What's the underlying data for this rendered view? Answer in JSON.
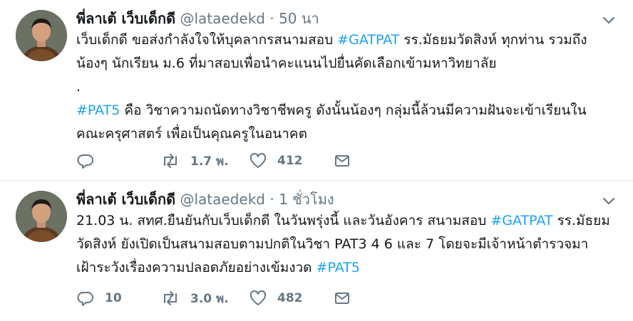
{
  "colors": {
    "link": "#1da1f2",
    "muted": "#657786",
    "text": "#14171a",
    "divider": "#e6ecf0"
  },
  "tweets": [
    {
      "author_name": "พี่ลาเต้ เว็บเด็กดี",
      "handle": "@lataedekd",
      "separator": "·",
      "time": "50 นา",
      "lines": [
        [
          {
            "text": "เว็บเด็กดี ขอส่งกำลังใจให้บุคลากรสนามสอบ ",
            "tag": false
          },
          {
            "text": "#GATPAT",
            "tag": true
          },
          {
            "text": " รร.มัธยมวัดสิงห์ ทุกท่าน รวมถึง",
            "tag": false
          }
        ],
        [
          {
            "text": "น้องๆ นักเรียน ม.6 ที่มาสอบเพื่อนำคะแนนไปยื่นคัดเลือกเข้ามหาวิทยาลัย",
            "tag": false
          }
        ],
        [
          {
            "text": ".",
            "tag": false
          }
        ],
        [
          {
            "text": "#PAT5",
            "tag": true
          },
          {
            "text": " คือ วิชาความถนัดทางวิชาชีพครู ดังนั้นน้องๆ กลุ่มนี้ล้วนมีความฝันจะเข้าเรียนใน",
            "tag": false
          }
        ],
        [
          {
            "text": "คณะครุศาสตร์ เพื่อเป็นคุณครูในอนาคต",
            "tag": false
          }
        ]
      ],
      "replies": "",
      "retweets": "1.7 พ.",
      "likes": "412",
      "icons": [
        "reply-icon",
        "retweet-icon",
        "like-icon",
        "direct-message-icon",
        "chevron-down-icon"
      ]
    },
    {
      "author_name": "พี่ลาเต้ เว็บเด็กดี",
      "handle": "@lataedekd",
      "separator": "·",
      "time": "1 ชั่วโมง",
      "lines": [
        [
          {
            "text": "21.03 น. สทศ.ยืนยันกับเว็บเด็กดี ในวันพรุ่งนี้ และวันอังคาร สนามสอบ ",
            "tag": false
          },
          {
            "text": "#GATPAT",
            "tag": true
          },
          {
            "text": " รร.มัธยม",
            "tag": false
          }
        ],
        [
          {
            "text": "วัดสิงห์ ยังเปิดเป็นสนามสอบตามปกติในวิชา PAT3 4 6 และ 7 โดยจะมีเจ้าหน้าตำรวจมา",
            "tag": false
          }
        ],
        [
          {
            "text": "เฝ้าระวังเรื่องความปลอดภัยอย่างเข้มงวด ",
            "tag": false
          },
          {
            "text": "#PAT5",
            "tag": true
          }
        ]
      ],
      "replies": "10",
      "retweets": "3.0 พ.",
      "likes": "482",
      "icons": [
        "reply-icon",
        "retweet-icon",
        "like-icon",
        "direct-message-icon",
        "chevron-down-icon"
      ]
    }
  ]
}
